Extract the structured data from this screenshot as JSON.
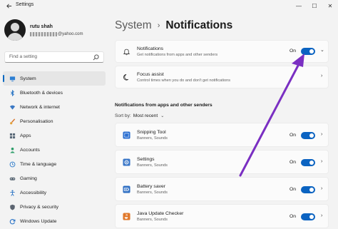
{
  "window": {
    "title": "Settings",
    "controls": {
      "minimize": "—",
      "maximize": "☐",
      "close": "✕"
    }
  },
  "user": {
    "name": "rutu shah",
    "email_domain": "@yahoo.com"
  },
  "search": {
    "placeholder": "Find a setting"
  },
  "sidebar": {
    "items": [
      {
        "label": "System",
        "icon": "monitor-icon",
        "active": true
      },
      {
        "label": "Bluetooth & devices",
        "icon": "bluetooth-icon"
      },
      {
        "label": "Network & internet",
        "icon": "wifi-icon"
      },
      {
        "label": "Personalisation",
        "icon": "brush-icon"
      },
      {
        "label": "Apps",
        "icon": "apps-icon"
      },
      {
        "label": "Accounts",
        "icon": "person-icon"
      },
      {
        "label": "Time & language",
        "icon": "globe-clock-icon"
      },
      {
        "label": "Gaming",
        "icon": "gamepad-icon"
      },
      {
        "label": "Accessibility",
        "icon": "accessibility-icon"
      },
      {
        "label": "Privacy & security",
        "icon": "shield-icon"
      },
      {
        "label": "Windows Update",
        "icon": "update-icon"
      }
    ]
  },
  "breadcrumb": {
    "parent": "System",
    "separator": "›",
    "current": "Notifications"
  },
  "notifications_card": {
    "title": "Notifications",
    "subtitle": "Get notifications from apps and other senders",
    "state_label": "On",
    "on": true,
    "expand_glyph": "⌄"
  },
  "focus_card": {
    "title": "Focus assist",
    "subtitle": "Control times when you do and don't get notifications",
    "chevron": "›"
  },
  "apps_section": {
    "title": "Notifications from apps and other senders",
    "sort_label": "Sort by:",
    "sort_value": "Most recent",
    "sort_chevron": "⌄",
    "apps": [
      {
        "name": "Snipping Tool",
        "detail": "Banners, Sounds",
        "state_label": "On",
        "on": true,
        "icon": "snipping-tool-icon",
        "color": "#2b6fd1"
      },
      {
        "name": "Settings",
        "detail": "Banners, Sounds",
        "state_label": "On",
        "on": true,
        "icon": "settings-gear-icon",
        "color": "#3c78c8"
      },
      {
        "name": "Battery saver",
        "detail": "Banners, Sounds",
        "state_label": "On",
        "on": true,
        "icon": "battery-saver-icon",
        "color": "#2f6fc3"
      },
      {
        "name": "Java Update Checker",
        "detail": "Banners, Sounds",
        "state_label": "On",
        "on": true,
        "icon": "java-icon",
        "color": "#e0782a"
      }
    ]
  },
  "colors": {
    "accent": "#0b63c1",
    "annotation_arrow": "#7a2fc2"
  }
}
